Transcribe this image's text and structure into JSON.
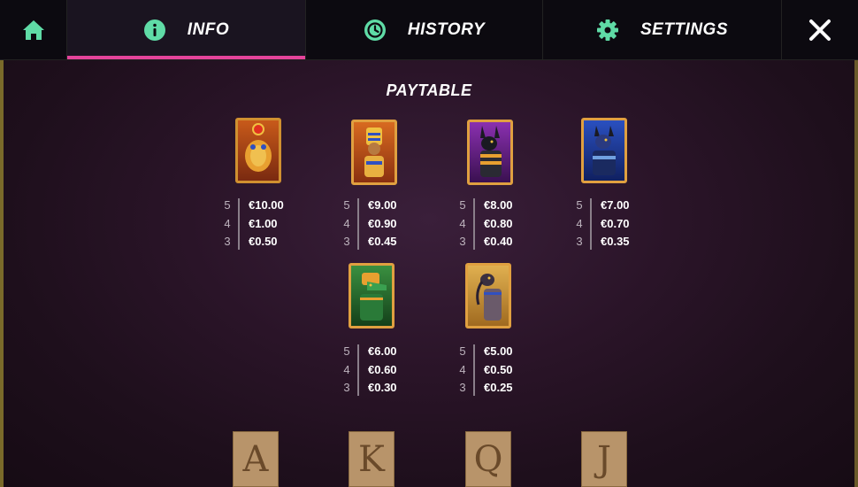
{
  "nav": {
    "tabs": [
      {
        "label": "INFO",
        "icon": "info-icon",
        "active": true
      },
      {
        "label": "HISTORY",
        "icon": "history-icon",
        "active": false
      },
      {
        "label": "SETTINGS",
        "icon": "gear-icon",
        "active": false
      }
    ],
    "home_icon": "home-icon",
    "close_icon": "close-icon"
  },
  "colors": {
    "accent": "#5fdba6",
    "active_underline": "#e4449a",
    "gold": "#e0a040"
  },
  "paytable": {
    "title": "PAYTABLE",
    "symbols": [
      {
        "name": "golden-scarab",
        "payouts": [
          {
            "count": "5",
            "value": "€10.00"
          },
          {
            "count": "4",
            "value": "€1.00"
          },
          {
            "count": "3",
            "value": "€0.50"
          }
        ]
      },
      {
        "name": "pharaoh",
        "payouts": [
          {
            "count": "5",
            "value": "€9.00"
          },
          {
            "count": "4",
            "value": "€0.90"
          },
          {
            "count": "3",
            "value": "€0.45"
          }
        ]
      },
      {
        "name": "anubis-purple",
        "payouts": [
          {
            "count": "5",
            "value": "€8.00"
          },
          {
            "count": "4",
            "value": "€0.80"
          },
          {
            "count": "3",
            "value": "€0.40"
          }
        ]
      },
      {
        "name": "anubis-blue",
        "payouts": [
          {
            "count": "5",
            "value": "€7.00"
          },
          {
            "count": "4",
            "value": "€0.70"
          },
          {
            "count": "3",
            "value": "€0.35"
          }
        ]
      },
      {
        "name": "sobek-green",
        "payouts": [
          {
            "count": "5",
            "value": "€6.00"
          },
          {
            "count": "4",
            "value": "€0.60"
          },
          {
            "count": "3",
            "value": "€0.30"
          }
        ]
      },
      {
        "name": "thoth-ibis",
        "payouts": [
          {
            "count": "5",
            "value": "€5.00"
          },
          {
            "count": "4",
            "value": "€0.50"
          },
          {
            "count": "3",
            "value": "€0.25"
          }
        ]
      }
    ],
    "low_cards": [
      "A",
      "K",
      "Q",
      "J"
    ]
  }
}
